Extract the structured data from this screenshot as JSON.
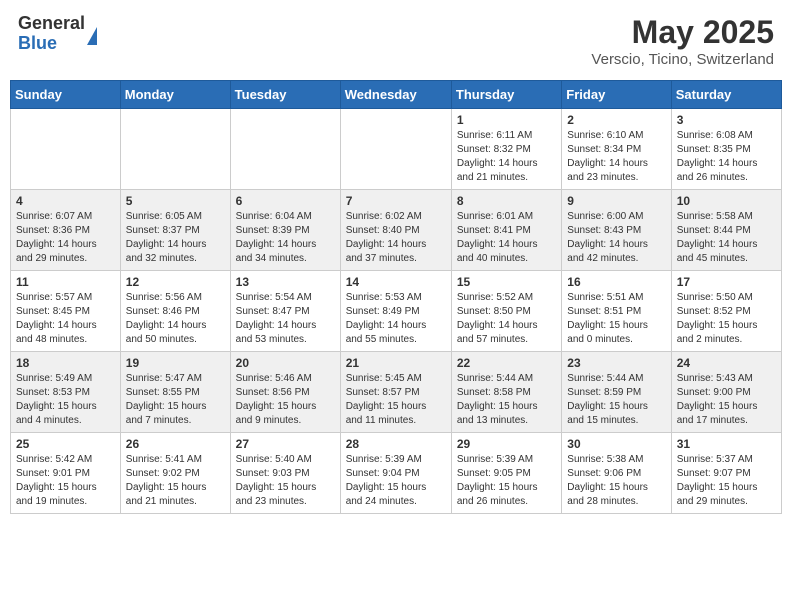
{
  "header": {
    "logo_general": "General",
    "logo_blue": "Blue",
    "title": "May 2025",
    "location": "Verscio, Ticino, Switzerland"
  },
  "weekdays": [
    "Sunday",
    "Monday",
    "Tuesday",
    "Wednesday",
    "Thursday",
    "Friday",
    "Saturday"
  ],
  "weeks": [
    [
      {
        "day": "",
        "info": ""
      },
      {
        "day": "",
        "info": ""
      },
      {
        "day": "",
        "info": ""
      },
      {
        "day": "",
        "info": ""
      },
      {
        "day": "1",
        "info": "Sunrise: 6:11 AM\nSunset: 8:32 PM\nDaylight: 14 hours\nand 21 minutes."
      },
      {
        "day": "2",
        "info": "Sunrise: 6:10 AM\nSunset: 8:34 PM\nDaylight: 14 hours\nand 23 minutes."
      },
      {
        "day": "3",
        "info": "Sunrise: 6:08 AM\nSunset: 8:35 PM\nDaylight: 14 hours\nand 26 minutes."
      }
    ],
    [
      {
        "day": "4",
        "info": "Sunrise: 6:07 AM\nSunset: 8:36 PM\nDaylight: 14 hours\nand 29 minutes."
      },
      {
        "day": "5",
        "info": "Sunrise: 6:05 AM\nSunset: 8:37 PM\nDaylight: 14 hours\nand 32 minutes."
      },
      {
        "day": "6",
        "info": "Sunrise: 6:04 AM\nSunset: 8:39 PM\nDaylight: 14 hours\nand 34 minutes."
      },
      {
        "day": "7",
        "info": "Sunrise: 6:02 AM\nSunset: 8:40 PM\nDaylight: 14 hours\nand 37 minutes."
      },
      {
        "day": "8",
        "info": "Sunrise: 6:01 AM\nSunset: 8:41 PM\nDaylight: 14 hours\nand 40 minutes."
      },
      {
        "day": "9",
        "info": "Sunrise: 6:00 AM\nSunset: 8:43 PM\nDaylight: 14 hours\nand 42 minutes."
      },
      {
        "day": "10",
        "info": "Sunrise: 5:58 AM\nSunset: 8:44 PM\nDaylight: 14 hours\nand 45 minutes."
      }
    ],
    [
      {
        "day": "11",
        "info": "Sunrise: 5:57 AM\nSunset: 8:45 PM\nDaylight: 14 hours\nand 48 minutes."
      },
      {
        "day": "12",
        "info": "Sunrise: 5:56 AM\nSunset: 8:46 PM\nDaylight: 14 hours\nand 50 minutes."
      },
      {
        "day": "13",
        "info": "Sunrise: 5:54 AM\nSunset: 8:47 PM\nDaylight: 14 hours\nand 53 minutes."
      },
      {
        "day": "14",
        "info": "Sunrise: 5:53 AM\nSunset: 8:49 PM\nDaylight: 14 hours\nand 55 minutes."
      },
      {
        "day": "15",
        "info": "Sunrise: 5:52 AM\nSunset: 8:50 PM\nDaylight: 14 hours\nand 57 minutes."
      },
      {
        "day": "16",
        "info": "Sunrise: 5:51 AM\nSunset: 8:51 PM\nDaylight: 15 hours\nand 0 minutes."
      },
      {
        "day": "17",
        "info": "Sunrise: 5:50 AM\nSunset: 8:52 PM\nDaylight: 15 hours\nand 2 minutes."
      }
    ],
    [
      {
        "day": "18",
        "info": "Sunrise: 5:49 AM\nSunset: 8:53 PM\nDaylight: 15 hours\nand 4 minutes."
      },
      {
        "day": "19",
        "info": "Sunrise: 5:47 AM\nSunset: 8:55 PM\nDaylight: 15 hours\nand 7 minutes."
      },
      {
        "day": "20",
        "info": "Sunrise: 5:46 AM\nSunset: 8:56 PM\nDaylight: 15 hours\nand 9 minutes."
      },
      {
        "day": "21",
        "info": "Sunrise: 5:45 AM\nSunset: 8:57 PM\nDaylight: 15 hours\nand 11 minutes."
      },
      {
        "day": "22",
        "info": "Sunrise: 5:44 AM\nSunset: 8:58 PM\nDaylight: 15 hours\nand 13 minutes."
      },
      {
        "day": "23",
        "info": "Sunrise: 5:44 AM\nSunset: 8:59 PM\nDaylight: 15 hours\nand 15 minutes."
      },
      {
        "day": "24",
        "info": "Sunrise: 5:43 AM\nSunset: 9:00 PM\nDaylight: 15 hours\nand 17 minutes."
      }
    ],
    [
      {
        "day": "25",
        "info": "Sunrise: 5:42 AM\nSunset: 9:01 PM\nDaylight: 15 hours\nand 19 minutes."
      },
      {
        "day": "26",
        "info": "Sunrise: 5:41 AM\nSunset: 9:02 PM\nDaylight: 15 hours\nand 21 minutes."
      },
      {
        "day": "27",
        "info": "Sunrise: 5:40 AM\nSunset: 9:03 PM\nDaylight: 15 hours\nand 23 minutes."
      },
      {
        "day": "28",
        "info": "Sunrise: 5:39 AM\nSunset: 9:04 PM\nDaylight: 15 hours\nand 24 minutes."
      },
      {
        "day": "29",
        "info": "Sunrise: 5:39 AM\nSunset: 9:05 PM\nDaylight: 15 hours\nand 26 minutes."
      },
      {
        "day": "30",
        "info": "Sunrise: 5:38 AM\nSunset: 9:06 PM\nDaylight: 15 hours\nand 28 minutes."
      },
      {
        "day": "31",
        "info": "Sunrise: 5:37 AM\nSunset: 9:07 PM\nDaylight: 15 hours\nand 29 minutes."
      }
    ]
  ]
}
